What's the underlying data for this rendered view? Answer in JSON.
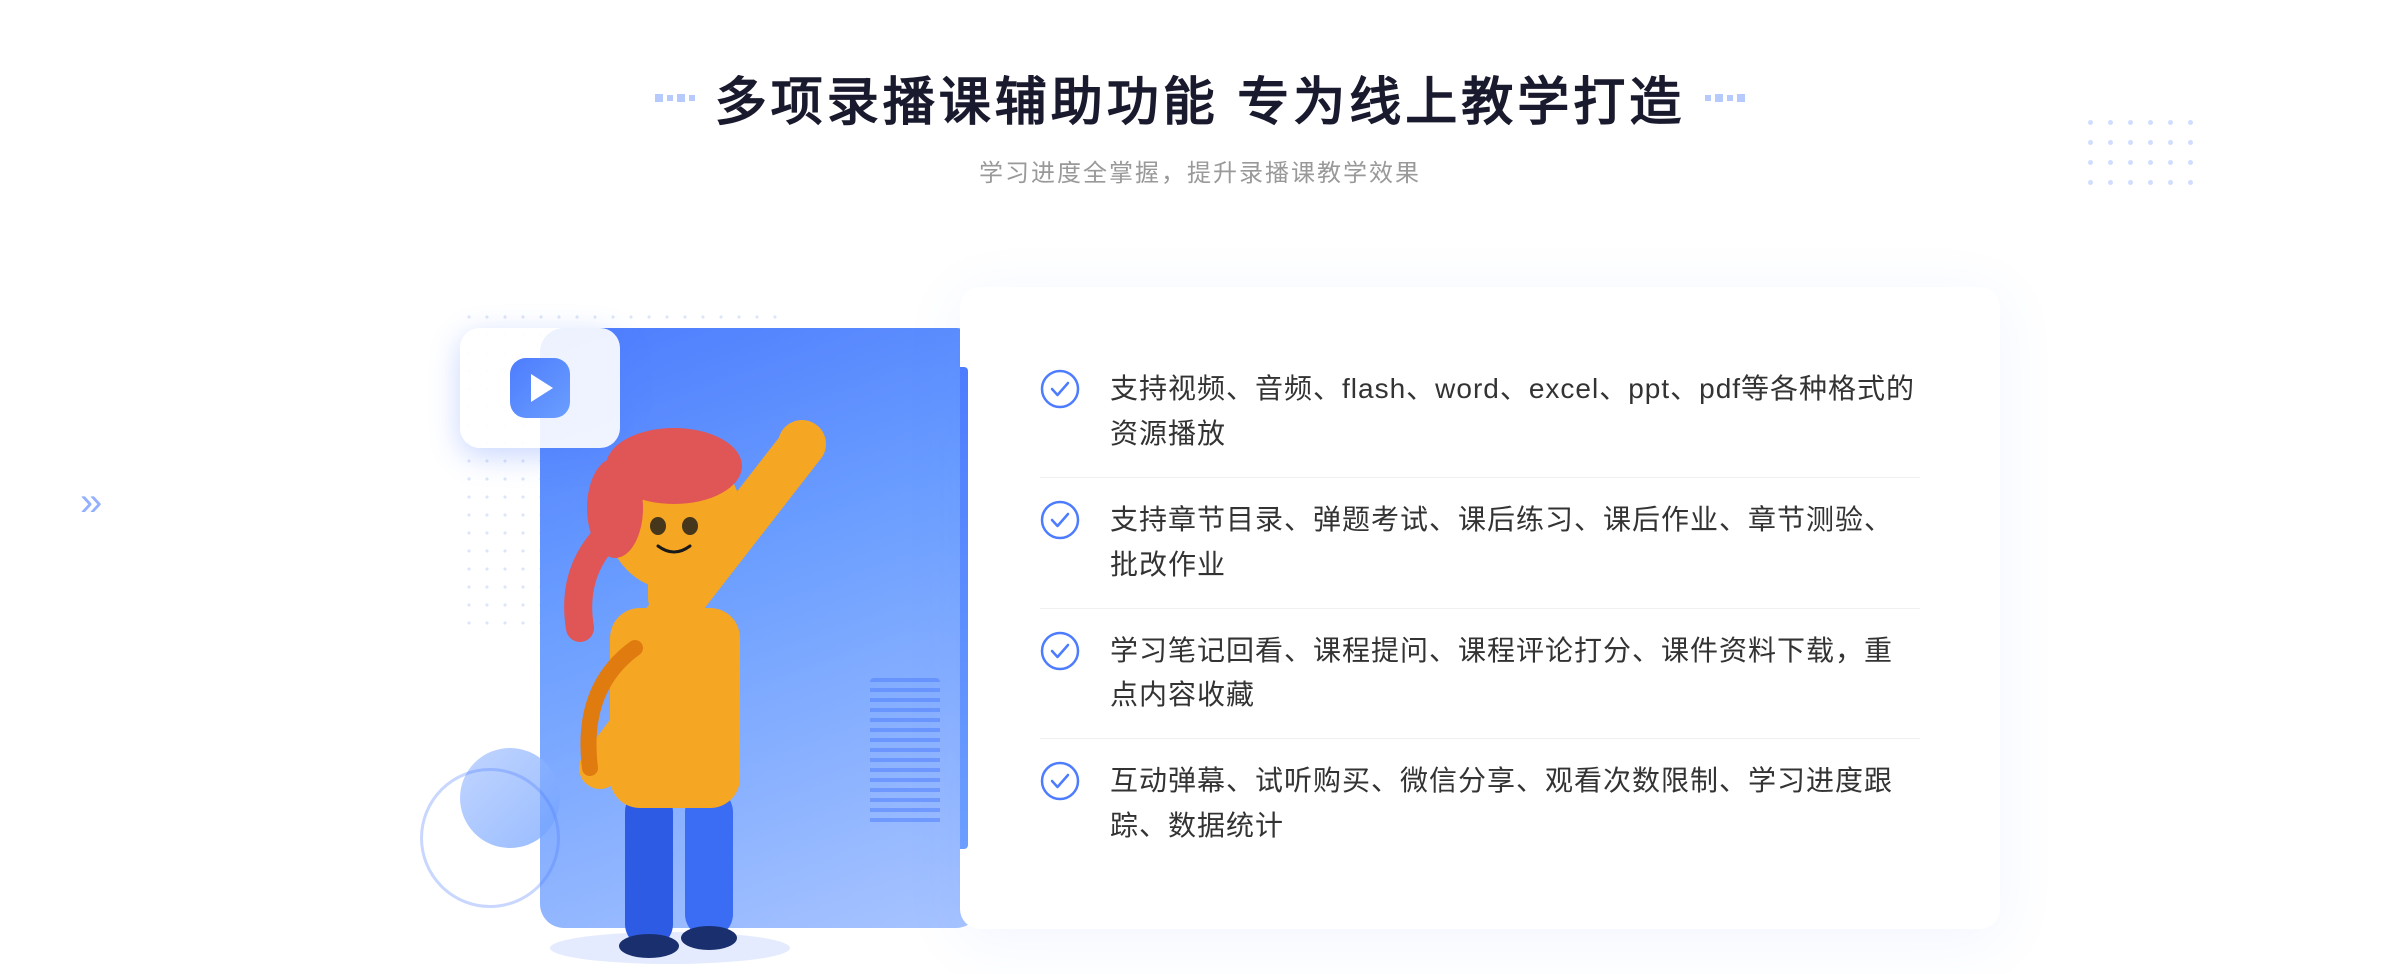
{
  "page": {
    "background": "#ffffff"
  },
  "header": {
    "title": "多项录播课辅助功能 专为线上教学打造",
    "subtitle": "学习进度全掌握，提升录播课教学效果",
    "title_deco_left": "⁞⁞",
    "title_deco_right": "⁞⁞"
  },
  "features": [
    {
      "id": 1,
      "text": "支持视频、音频、flash、word、excel、ppt、pdf等各种格式的资源播放"
    },
    {
      "id": 2,
      "text": "支持章节目录、弹题考试、课后练习、课后作业、章节测验、批改作业"
    },
    {
      "id": 3,
      "text": "学习笔记回看、课程提问、课程评论打分、课件资料下载，重点内容收藏"
    },
    {
      "id": 4,
      "text": "互动弹幕、试听购买、微信分享、观看次数限制、学习进度跟踪、数据统计"
    }
  ],
  "colors": {
    "primary": "#4d7cfe",
    "primary_light": "#6b9eff",
    "text_dark": "#1a1a2e",
    "text_medium": "#333333",
    "text_light": "#999999"
  },
  "icons": {
    "check_circle": "check-circle",
    "play": "play-icon",
    "chevron": "chevron-right-icon"
  }
}
